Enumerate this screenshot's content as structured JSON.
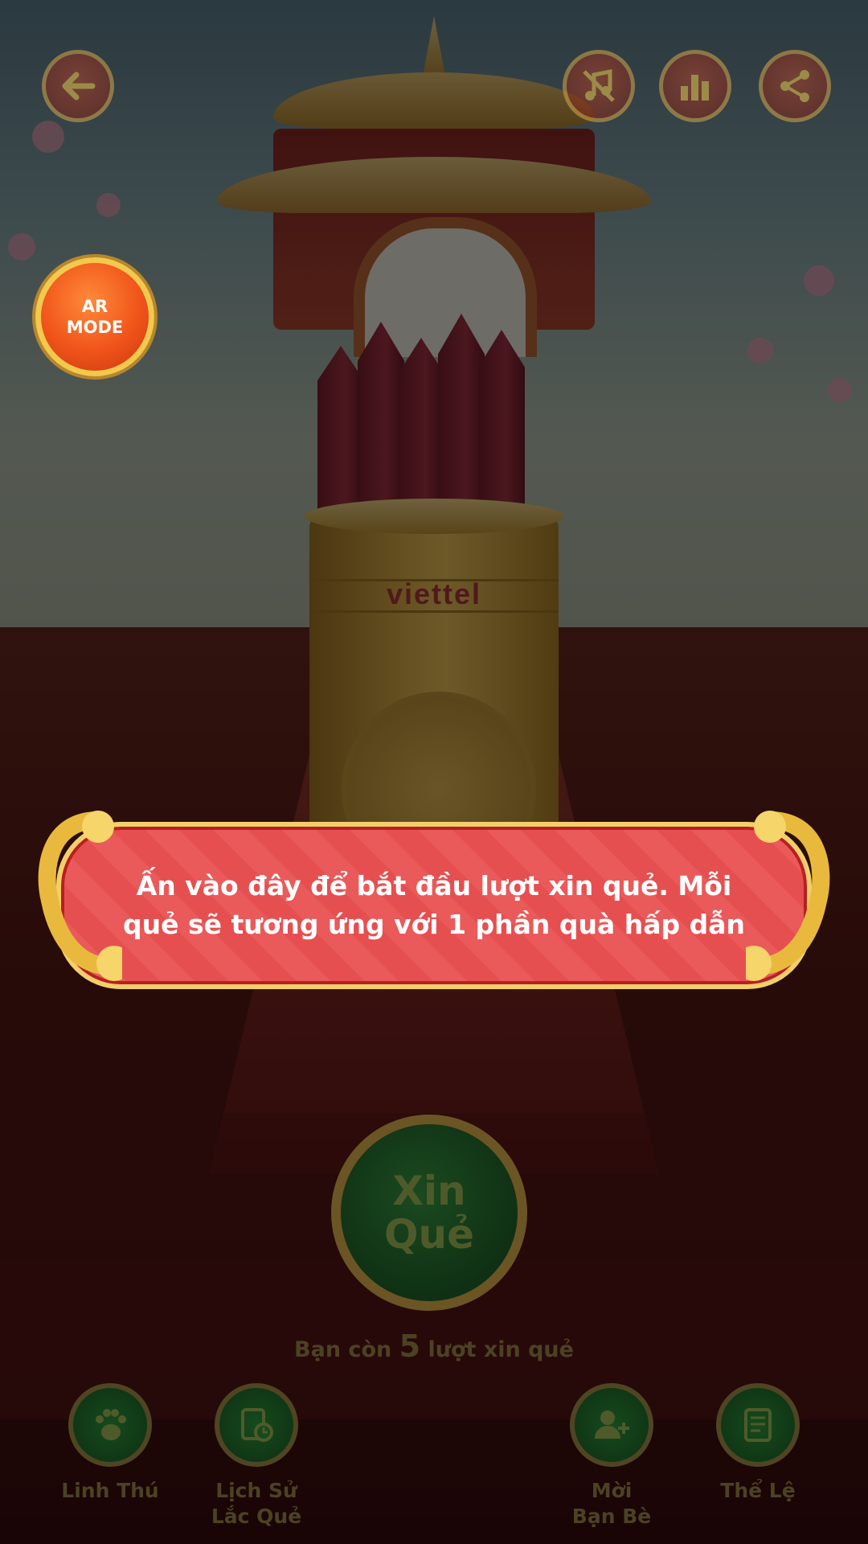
{
  "top_bar": {
    "back_icon": "arrow-left-icon",
    "mute_icon": "music-off-icon",
    "leaderboard_icon": "bar-chart-icon",
    "share_icon": "share-icon"
  },
  "ar_mode": {
    "label": "AR\nMODE"
  },
  "cylinder": {
    "brand": "viettel"
  },
  "tooltip": {
    "text": "Ấn vào đây để bắt đầu lượt xin quẻ. Mỗi quẻ sẽ tương ứng với 1 phần quà hấp dẫn"
  },
  "main_button": {
    "label": "Xin\nQuẻ"
  },
  "turns": {
    "prefix": "Bạn còn",
    "count": "5",
    "suffix": "lượt xin quẻ"
  },
  "bottom_nav": [
    {
      "label": "Linh Thú",
      "icon": "paw-icon"
    },
    {
      "label": "Lịch Sử\nLắc Quẻ",
      "icon": "history-icon"
    },
    {
      "label": "Mời\nBạn Bè",
      "icon": "add-friend-icon"
    },
    {
      "label": "Thể Lệ",
      "icon": "scroll-rules-icon"
    }
  ],
  "colors": {
    "tooltip_red": "#e64f50",
    "gold": "#f3cf6a",
    "ar_orange": "#f0541a",
    "main_green": "#164a1d"
  }
}
